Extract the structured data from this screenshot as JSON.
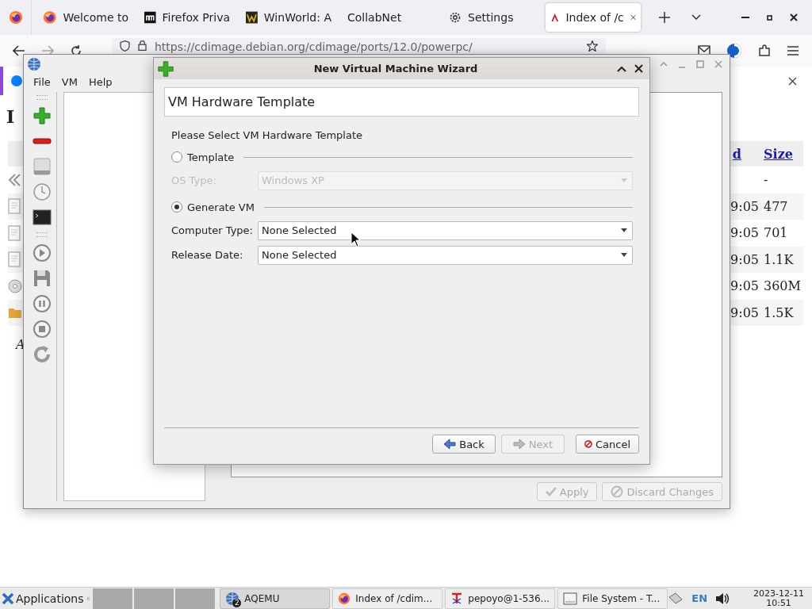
{
  "browser": {
    "tabs": [
      {
        "kind": "firefox",
        "label": "Welcome to",
        "selected": false
      },
      {
        "kind": "dark-square",
        "label": "Firefox Priva",
        "selected": false
      },
      {
        "kind": "gold-square",
        "label": "WinWorld: A",
        "selected": false
      },
      {
        "kind": "none",
        "label": "CollabNet",
        "selected": false
      },
      {
        "kind": "gear",
        "label": "Settings",
        "selected": false
      },
      {
        "kind": "arch",
        "label": "Index of /c",
        "selected": true
      }
    ],
    "url": "https://cdimage.debian.org/cdimage/ports/12.0/powerpc/",
    "page": {
      "heading": "I",
      "columns": [
        "d",
        "Size"
      ],
      "rows": [
        {
          "kind": "parent",
          "size": "-"
        },
        {
          "kind": "file",
          "column_1": "9:05",
          "size": "477"
        },
        {
          "kind": "file",
          "column_1": "9:05",
          "size": "701"
        },
        {
          "kind": "file",
          "column_1": "9:05",
          "size": "1.1K"
        },
        {
          "kind": "disc",
          "column_1": "9:05",
          "size": "360M"
        },
        {
          "kind": "folder",
          "column_1": "9:05",
          "size": "1.5K"
        }
      ],
      "footer": "A"
    }
  },
  "aqemu": {
    "menu": [
      "File",
      "VM",
      "Help"
    ],
    "buttons": [
      {
        "kind": "check",
        "label": "Apply",
        "disabled": true
      },
      {
        "kind": "forbid",
        "label": "Discard Changes",
        "disabled": true
      }
    ]
  },
  "wizard": {
    "title": "New Virtual Machine Wizard",
    "header": "VM Hardware Template",
    "prompt": "Please Select VM Hardware Template",
    "template_option": {
      "label": "Template",
      "selected": false
    },
    "os_type": {
      "label": "OS Type:",
      "value": "Windows XP",
      "disabled": true
    },
    "generate_option": {
      "label": "Generate VM",
      "selected": true
    },
    "computer_type": {
      "label": "Computer Type:",
      "value": "None Selected",
      "disabled": false
    },
    "release_date": {
      "label": "Release Date:",
      "value": "None Selected",
      "disabled": false
    },
    "buttons": [
      {
        "kind": "back",
        "label": "Back",
        "disabled": false
      },
      {
        "kind": "next",
        "label": "Next",
        "disabled": true
      },
      {
        "kind": "cancel",
        "label": "Cancel",
        "disabled": false
      }
    ]
  },
  "taskbar": {
    "start": "Applications",
    "tasks": [
      {
        "kind": "aqemu",
        "label": "AQEMU",
        "badge": "2",
        "selected": true
      },
      {
        "kind": "firefox",
        "label": "Index of /cdim...",
        "selected": false
      },
      {
        "kind": "terminal",
        "label": "pepoyo@1-536...",
        "selected": false
      },
      {
        "kind": "window",
        "label": "File System - T...",
        "selected": false
      }
    ],
    "language": "EN",
    "date": "2023-12-11",
    "time": "10:51"
  }
}
